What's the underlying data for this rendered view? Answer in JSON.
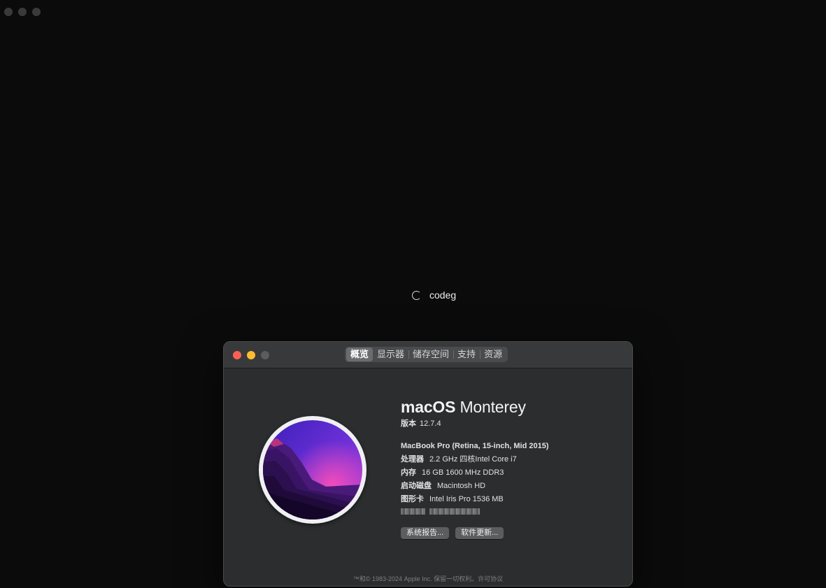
{
  "loading": {
    "label": "codeg"
  },
  "tabs": [
    {
      "label": "概览",
      "active": true
    },
    {
      "label": "显示器",
      "active": false
    },
    {
      "label": "储存空间",
      "active": false
    },
    {
      "label": "支持",
      "active": false
    },
    {
      "label": "资源",
      "active": false
    }
  ],
  "about": {
    "os_brand": "macOS",
    "os_name": "Monterey",
    "version_key": "版本",
    "version_value": "12.7.4",
    "model": "MacBook Pro (Retina, 15-inch, Mid 2015)",
    "processor_key": "处理器",
    "processor_value": "2.2 GHz 四核Intel Core i7",
    "memory_key": "内存",
    "memory_value": "16 GB 1600 MHz DDR3",
    "disk_key": "启动磁盘",
    "disk_value": "Macintosh HD",
    "graphics_key": "图形卡",
    "graphics_value": "Intel Iris Pro 1536 MB",
    "system_report_button": "系统报告...",
    "software_update_button": "软件更新...",
    "copyright": "™和© 1983-2024 Apple Inc. 保留一切权利。许可协议"
  },
  "colors": {
    "close": "#ff5f57",
    "minimize": "#febc2e",
    "maximize_disabled": "#5b5c5e"
  }
}
